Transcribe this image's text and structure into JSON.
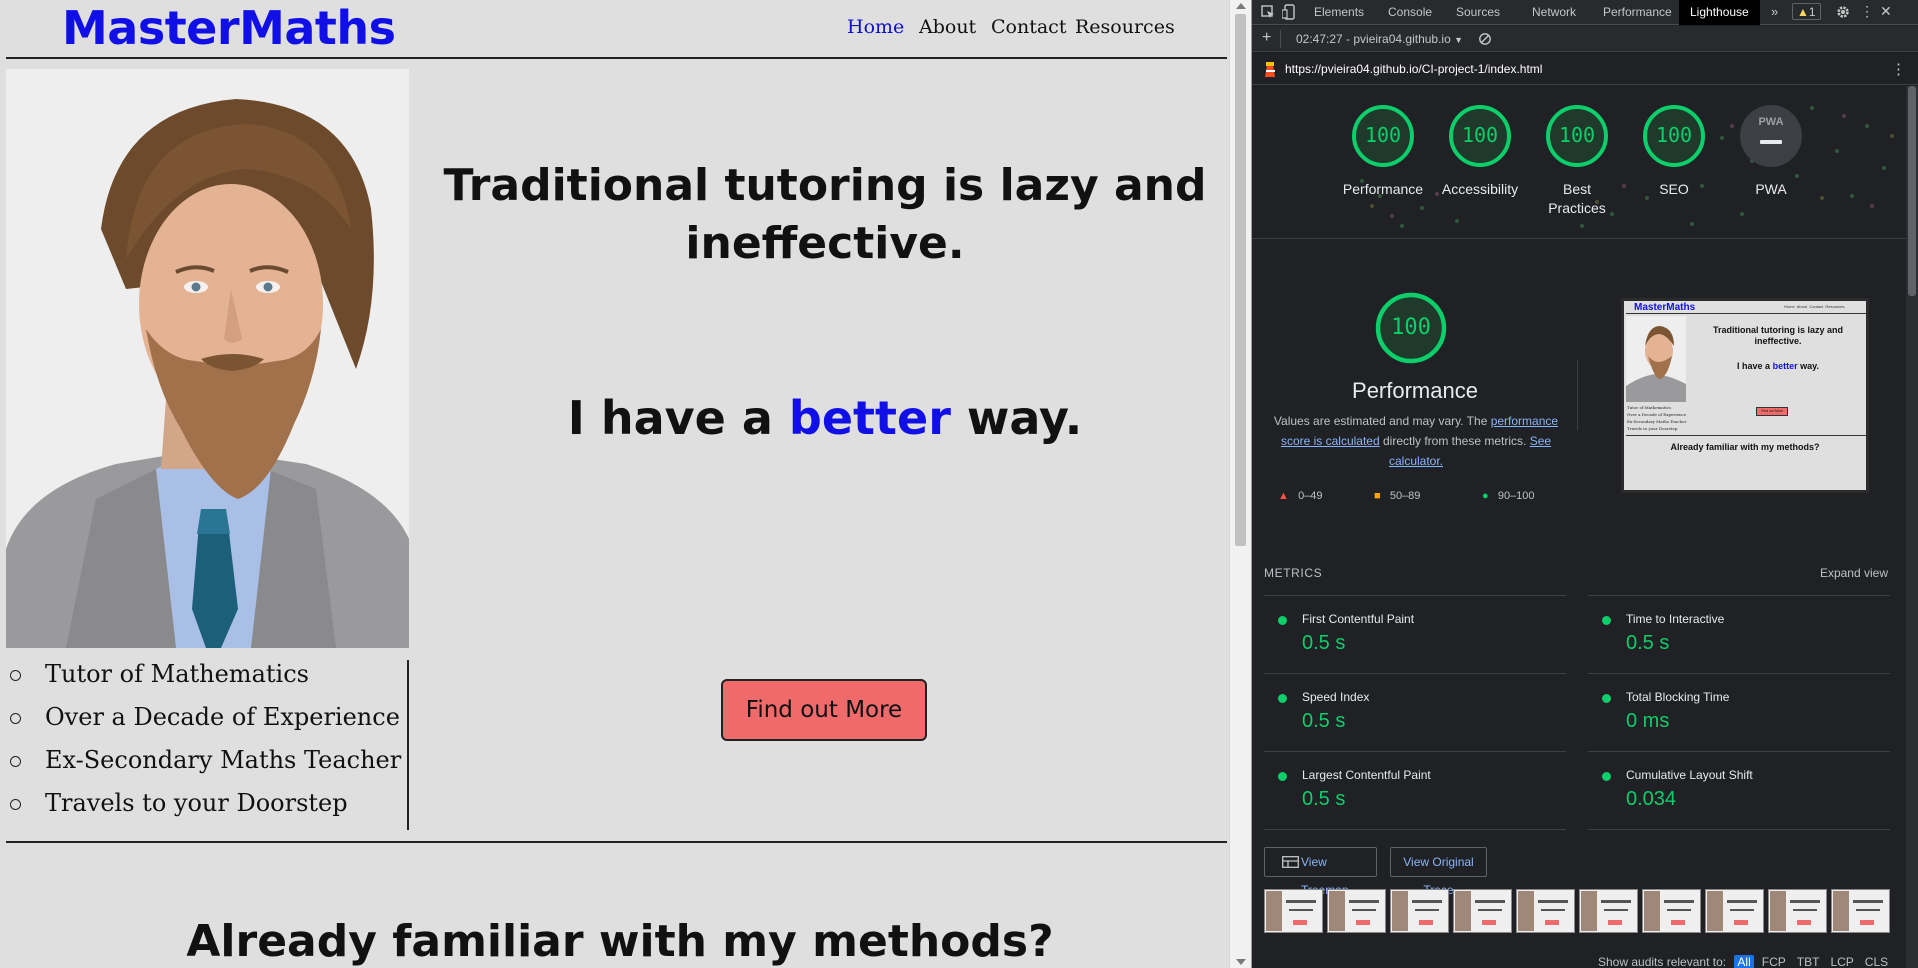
{
  "site": {
    "logo": "MasterMaths",
    "nav": [
      {
        "label": "Home",
        "active": true
      },
      {
        "label": "About",
        "active": false
      },
      {
        "label": "Contact",
        "active": false
      },
      {
        "label": "Resources",
        "active": false
      }
    ],
    "headline": "Traditional tutoring is lazy and ineffective.",
    "subhead": {
      "pre": "I have a ",
      "accent": "better",
      "post": " way."
    },
    "bullets": [
      "Tutor of Mathematics",
      "Over a Decade of Experience",
      "Ex-Secondary Maths Teacher",
      "Travels to your Doorstep"
    ],
    "cta_label": "Find out More",
    "section_heading": "Already familiar with my methods?",
    "colors": {
      "brand": "#1010e6",
      "cta": "#ef6b6b",
      "background": "#dfdfdf"
    }
  },
  "devtools": {
    "tabs": [
      "Elements",
      "Console",
      "Sources",
      "Network",
      "Performance",
      "Lighthouse"
    ],
    "active_tab": "Lighthouse",
    "warning_count": "1",
    "report_selector": "02:47:27 - pvieira04.github.io",
    "url": "https://pvieira04.github.io/CI-project-1/index.html",
    "scores": [
      {
        "label": "Performance",
        "score": "100"
      },
      {
        "label": "Accessibility",
        "score": "100"
      },
      {
        "label": "Best Practices",
        "score": "100"
      },
      {
        "label": "SEO",
        "score": "100"
      },
      {
        "label": "PWA",
        "score": ""
      }
    ],
    "pwa_badge": "PWA",
    "performance": {
      "score": "100",
      "title": "Performance",
      "desc_pre": "Values are estimated and may vary. The ",
      "desc_link1": "performance score is calculated",
      "desc_mid": " directly from these metrics. ",
      "desc_link2": "See calculator.",
      "legend": [
        "0–49",
        "50–89",
        "90–100"
      ]
    },
    "preview": {
      "logo": "MasterMaths",
      "nav": "Home  About  Contact  Resources",
      "headline": "Traditional tutoring is lazy and ineffective.",
      "subhead_pre": "I have a ",
      "subhead_accent": "better",
      "subhead_post": " way.",
      "bullets": [
        "Tutor of Mathematics",
        "Over a Decade of Experience",
        "Ex-Secondary Maths Teacher",
        "Travels to your Doorstep"
      ],
      "cta": "Find out More",
      "footer": "Already familiar with my methods?"
    },
    "metrics_heading": "METRICS",
    "expand_label": "Expand view",
    "metrics": [
      {
        "name": "First Contentful Paint",
        "value": "0.5 s"
      },
      {
        "name": "Time to Interactive",
        "value": "0.5 s"
      },
      {
        "name": "Speed Index",
        "value": "0.5 s"
      },
      {
        "name": "Total Blocking Time",
        "value": "0 ms"
      },
      {
        "name": "Largest Contentful Paint",
        "value": "0.5 s"
      },
      {
        "name": "Cumulative Layout Shift",
        "value": "0.034"
      }
    ],
    "buttons": {
      "treemap": "View Treemap",
      "trace": "View Original Trace"
    },
    "audits_label": "Show audits relevant to:",
    "audit_chips": [
      "All",
      "FCP",
      "TBT",
      "LCP",
      "CLS"
    ],
    "status_colors": {
      "pass": "#0cce6b",
      "average": "#ffa400",
      "fail": "#ff4e42"
    }
  }
}
